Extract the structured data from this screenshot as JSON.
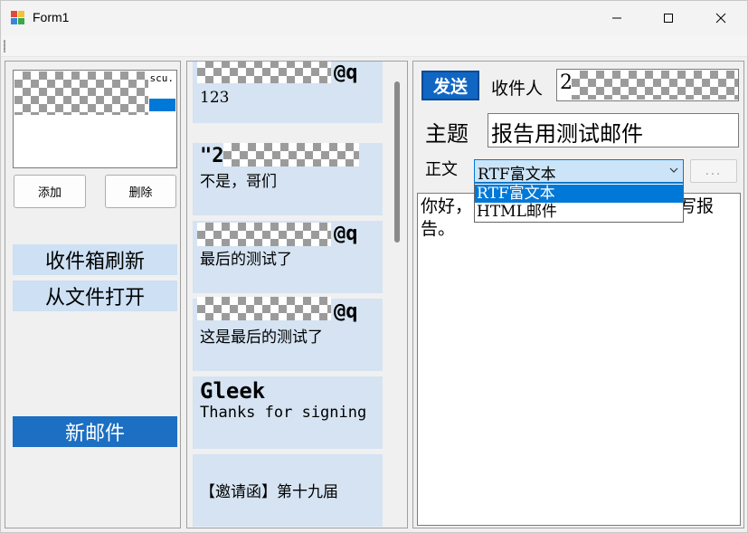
{
  "window": {
    "title": "Form1",
    "minimize_icon": "minimize-icon",
    "maximize_icon": "maximize-icon",
    "close_icon": "close-icon"
  },
  "left": {
    "account_suffix": "scu.",
    "add_label": "添加",
    "delete_label": "删除",
    "refresh_label": "收件箱刷新",
    "open_file_label": "从文件打开",
    "new_mail_label": "新邮件"
  },
  "mails": [
    {
      "from": "@q",
      "preview": "123"
    },
    {
      "from": "\"2",
      "preview": "不是，哥们"
    },
    {
      "from": "@q",
      "preview": "最后的测试了"
    },
    {
      "from": "@q",
      "preview": "这是最后的测试了"
    },
    {
      "from": "Gleek",
      "preview": "Thanks for signing"
    },
    {
      "from": "",
      "preview": "【邀请函】第十九届"
    }
  ],
  "compose": {
    "send_label": "发送",
    "recipient_label": "收件人",
    "recipient_value": "2",
    "subject_label": "主题",
    "subject_value": "报告用测试邮件",
    "body_label": "正文",
    "format_selected": "RTF富文本",
    "format_options": [
      "RTF富文本",
      "HTML邮件"
    ],
    "ellipsis_label": "...",
    "body_line1_start": "你好，",
    "body_line1_end": "写报",
    "body_line2": "告。"
  },
  "colors": {
    "accent": "#0078d7",
    "send_button": "#1166c4",
    "new_mail_button": "#1c6fc2",
    "light_button": "#cde0f4",
    "mail_item": "#d5e3f2"
  }
}
